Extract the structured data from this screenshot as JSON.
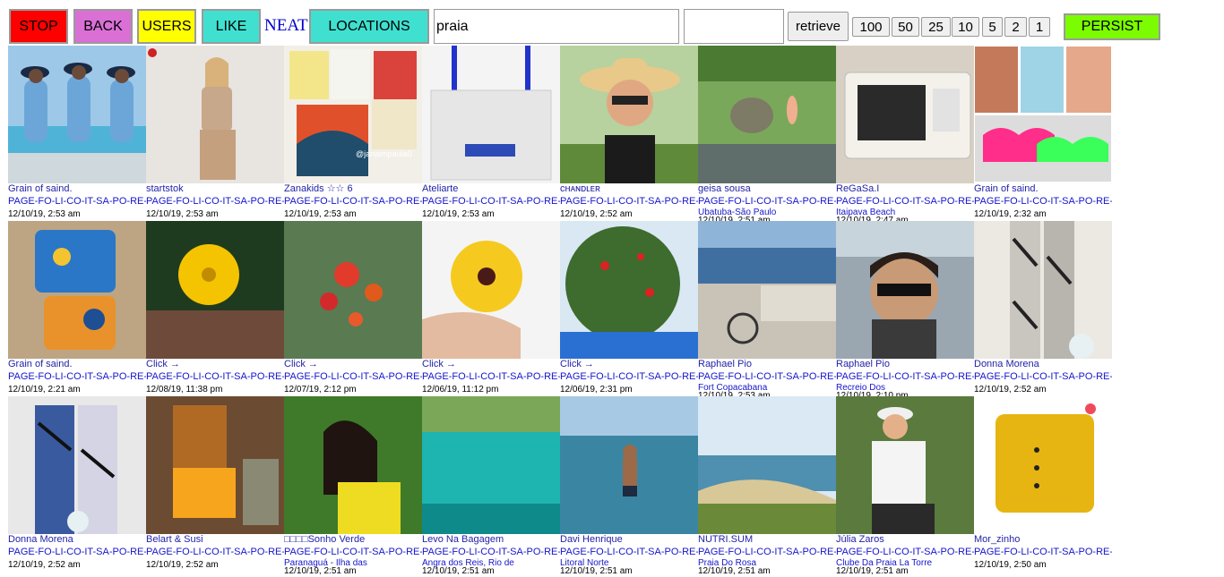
{
  "toolbar": {
    "stop": {
      "label": "STOP",
      "color": "#ff0000"
    },
    "back": {
      "label": "BACK",
      "color": "#da70d6"
    },
    "users": {
      "label": "USERS",
      "color": "#ffff00"
    },
    "like": {
      "label": "LIKE",
      "color": "#40e0d0"
    },
    "neat": "NEAT",
    "locations": {
      "label": "LOCATIONS",
      "color": "#40e0d0"
    },
    "search_value": "praia",
    "second_value": "",
    "retrieve": "retrieve",
    "counts": [
      "100",
      "50",
      "25",
      "10",
      "5",
      "2",
      "1"
    ],
    "persist": {
      "label": "PERSIST",
      "color": "#7cfc00"
    }
  },
  "posts": [
    {
      "user": "Grain of saind.",
      "tag": "PAGE-FO-LI-CO-IT-SA-PO-RE-",
      "loc": "",
      "time": "12/10/19, 2:53 am",
      "scene": "beach-women"
    },
    {
      "user": "startstok",
      "tag": "PAGE-FO-LI-CO-IT-SA-PO-RE-",
      "loc": "",
      "time": "12/10/19, 2:53 am",
      "scene": "woman-overalls"
    },
    {
      "user": "Zanakids ☆☆ 6",
      "tag": "PAGE-FO-LI-CO-IT-SA-PO-RE-",
      "loc": "",
      "time": "12/10/19, 2:53 am",
      "scene": "tshirts"
    },
    {
      "user": "Ateliarte",
      "tag": "PAGE-FO-LI-CO-IT-SA-PO-RE-",
      "loc": "",
      "time": "12/10/19, 2:53 am",
      "scene": "tote-bag"
    },
    {
      "user": "ᴄʜᴀɴᴅʟᴇʀ",
      "tag": "PAGE-FO-LI-CO-IT-SA-PO-RE-",
      "loc": "",
      "time": "12/10/19, 2:52 am",
      "scene": "hat-selfie"
    },
    {
      "user": "geisa sousa",
      "tag": "PAGE-FO-LI-CO-IT-SA-PO-RE-",
      "loc": "Ubatuba-São Paulo",
      "time": "12/10/19, 2:51 am",
      "scene": "waterfall"
    },
    {
      "user": "ReGaSa.I",
      "tag": "PAGE-FO-LI-CO-IT-SA-PO-RE-",
      "loc": "Itaipava Beach",
      "time": "12/10/19, 2:47 am",
      "scene": "microwave"
    },
    {
      "user": "Grain of saind.",
      "tag": "PAGE-FO-LI-CO-IT-SA-PO-RE-",
      "loc": "",
      "time": "12/10/19, 2:32 am",
      "scene": "bikini-collage"
    },
    {
      "user": "Grain of saind.",
      "tag": "PAGE-FO-LI-CO-IT-SA-PO-RE-",
      "loc": "",
      "time": "12/10/19, 2:21 am",
      "scene": "butterfly-swimsuit"
    },
    {
      "user": "Click →",
      "tag": "PAGE-FO-LI-CO-IT-SA-PO-RE-",
      "loc": "",
      "time": "12/08/19, 11:38 pm",
      "scene": "yellow-flower"
    },
    {
      "user": "Click →",
      "tag": "PAGE-FO-LI-CO-IT-SA-PO-RE-",
      "loc": "",
      "time": "12/07/19, 2:12 pm",
      "scene": "red-flowers"
    },
    {
      "user": "Click →",
      "tag": "PAGE-FO-LI-CO-IT-SA-PO-RE-",
      "loc": "",
      "time": "12/06/19, 11:12 pm",
      "scene": "hand-flower"
    },
    {
      "user": "Click →",
      "tag": "PAGE-FO-LI-CO-IT-SA-PO-RE-",
      "loc": "",
      "time": "12/06/19, 2:31 pm",
      "scene": "tree-red"
    },
    {
      "user": "Raphael Pio",
      "tag": "PAGE-FO-LI-CO-IT-SA-PO-RE-",
      "loc": "Fort Copacabana",
      "time": "12/10/19, 2:53 am",
      "scene": "fort"
    },
    {
      "user": "Raphael Pio",
      "tag": "PAGE-FO-LI-CO-IT-SA-PO-RE-",
      "loc": "Recreio Dos",
      "time": "12/10/19, 2:10 pm",
      "scene": "car-selfie"
    },
    {
      "user": "Donna Morena",
      "tag": "PAGE-FO-LI-CO-IT-SA-PO-RE-",
      "loc": "",
      "time": "12/10/19, 2:52 am",
      "scene": "pants-print"
    },
    {
      "user": "Donna Morena",
      "tag": "PAGE-FO-LI-CO-IT-SA-PO-RE-",
      "loc": "",
      "time": "12/10/19, 2:52 am",
      "scene": "pants-print2"
    },
    {
      "user": "Belart & Susi",
      "tag": "PAGE-FO-LI-CO-IT-SA-PO-RE-",
      "loc": "",
      "time": "12/10/19, 2:52 am",
      "scene": "top-skirt"
    },
    {
      "user": "□□□□Sonho Verde",
      "tag": "PAGE-FO-LI-CO-IT-SA-PO-RE-",
      "loc": "Paranaguá - Ilha das",
      "time": "12/10/19, 2:51 am",
      "scene": "woman-yellow"
    },
    {
      "user": "Levo Na Bagagem",
      "tag": "PAGE-FO-LI-CO-IT-SA-PO-RE-",
      "loc": "Angra dos Reis, Rio de",
      "time": "12/10/19, 2:51 am",
      "scene": "lagoon"
    },
    {
      "user": "Davi Henrique",
      "tag": "PAGE-FO-LI-CO-IT-SA-PO-RE-",
      "loc": "Litoral Norte",
      "time": "12/10/19, 2:51 am",
      "scene": "sea-man"
    },
    {
      "user": "NUTRI.SUM",
      "tag": "PAGE-FO-LI-CO-IT-SA-PO-RE-",
      "loc": "Praia Do Rosa",
      "time": "12/10/19, 2:51 am",
      "scene": "bay-view"
    },
    {
      "user": "Júlia Zaros",
      "tag": "PAGE-FO-LI-CO-IT-SA-PO-RE-",
      "loc": "Clube Da Praia La Torre",
      "time": "12/10/19, 2:51 am",
      "scene": "girl-cap"
    },
    {
      "user": "Mor_zinho",
      "tag": "PAGE-FO-LI-CO-IT-SA-PO-RE-",
      "loc": "",
      "time": "12/10/19, 2:50 am",
      "scene": "yellow-top"
    }
  ]
}
